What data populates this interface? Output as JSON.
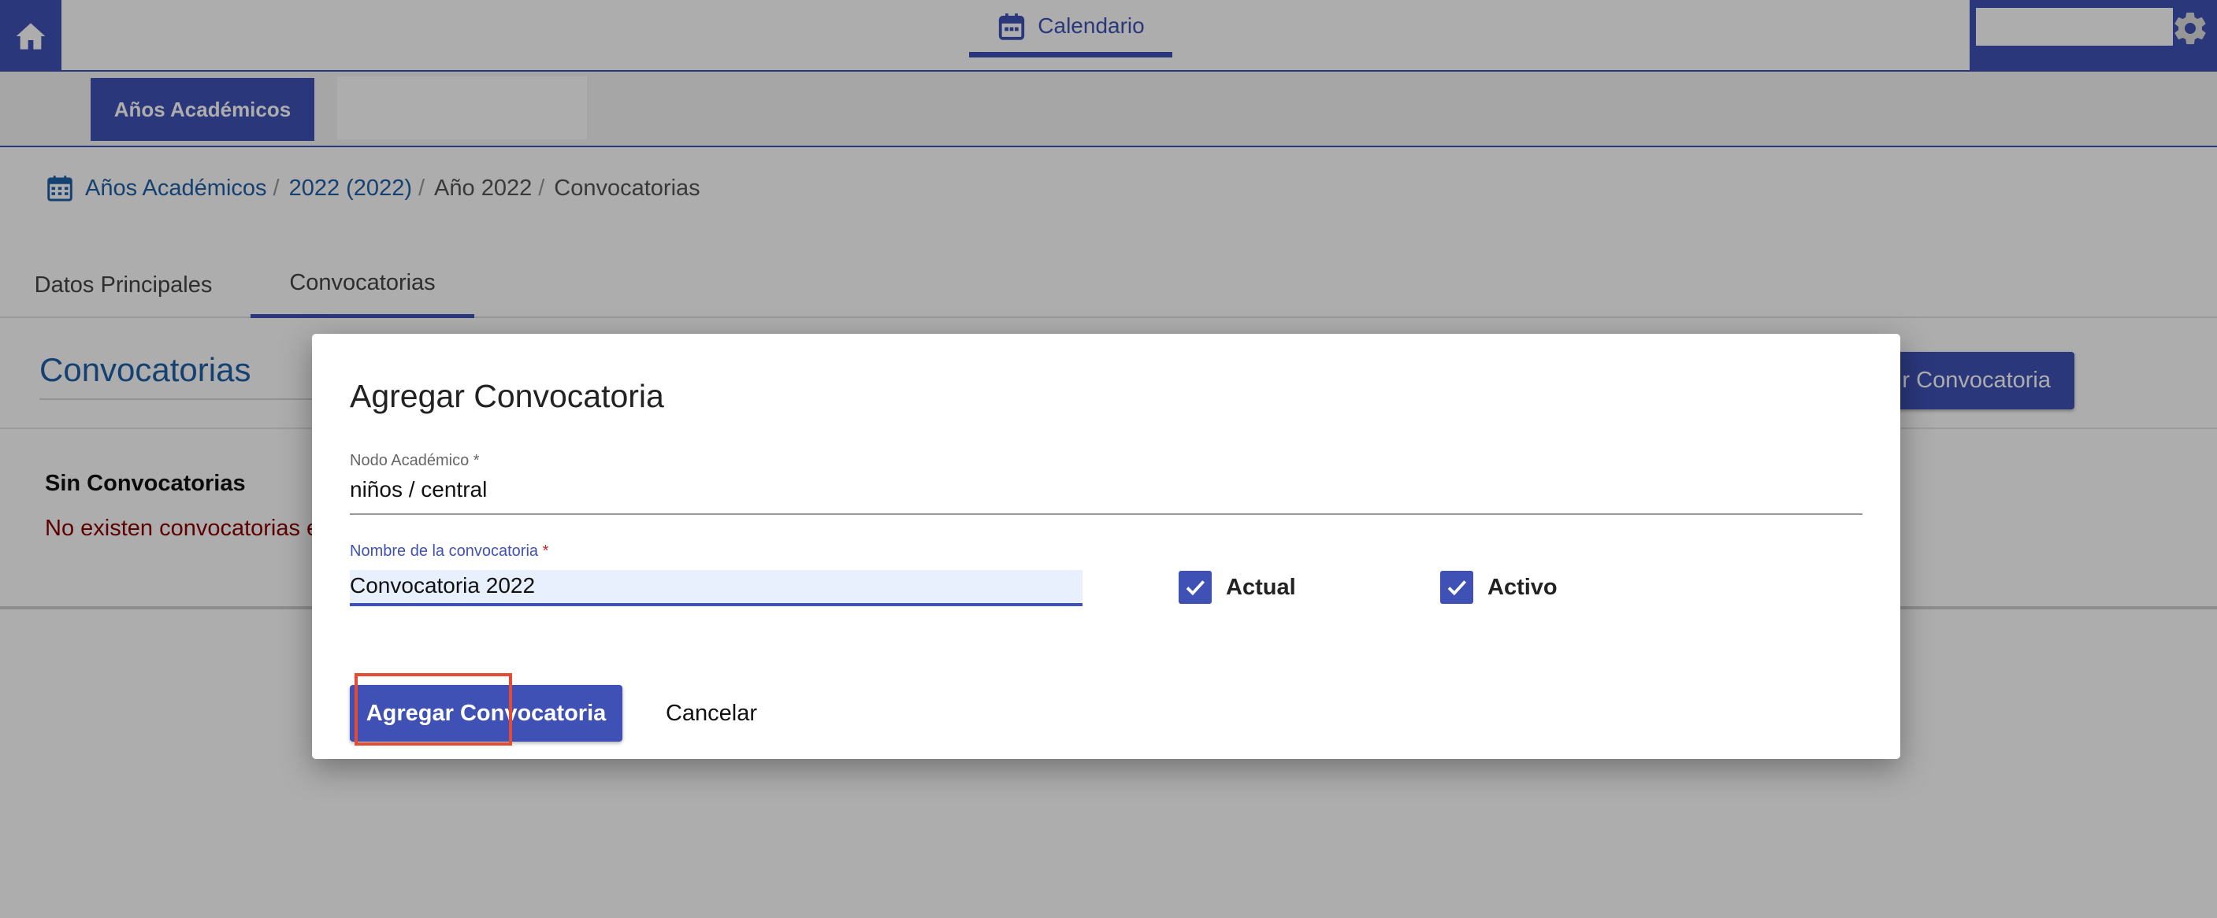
{
  "nav": {
    "calendar_label": "Calendario"
  },
  "subnav": {
    "active_label": "Años Académicos"
  },
  "breadcrumb": {
    "items": [
      "Años Académicos",
      "2022 (2022)",
      "Año 2022",
      "Convocatorias"
    ],
    "separator": "/"
  },
  "tabs": [
    "Datos Principales",
    "Convocatorias"
  ],
  "section": {
    "title": "Convocatorias",
    "add_button_visible": "r Convocatoria",
    "empty_title": "Sin Convocatorias",
    "empty_text_visible": "No existen convocatorias e"
  },
  "dialog": {
    "title": "Agregar Convocatoria",
    "field1": {
      "label": "Nodo Académico",
      "required_mark": "*",
      "value": "niños / central"
    },
    "field2": {
      "label": "Nombre de la convocatoria",
      "required_mark": "*",
      "value": "Convocatoria 2022"
    },
    "checkbox_actual": "Actual",
    "checkbox_activo": "Activo",
    "submit_label": "Agregar Convocatoria",
    "cancel_label": "Cancelar"
  },
  "colors": {
    "primary": "#3f51b5",
    "link": "#1f5fa8",
    "error_text": "#8b0000",
    "highlight": "#e24c35"
  }
}
